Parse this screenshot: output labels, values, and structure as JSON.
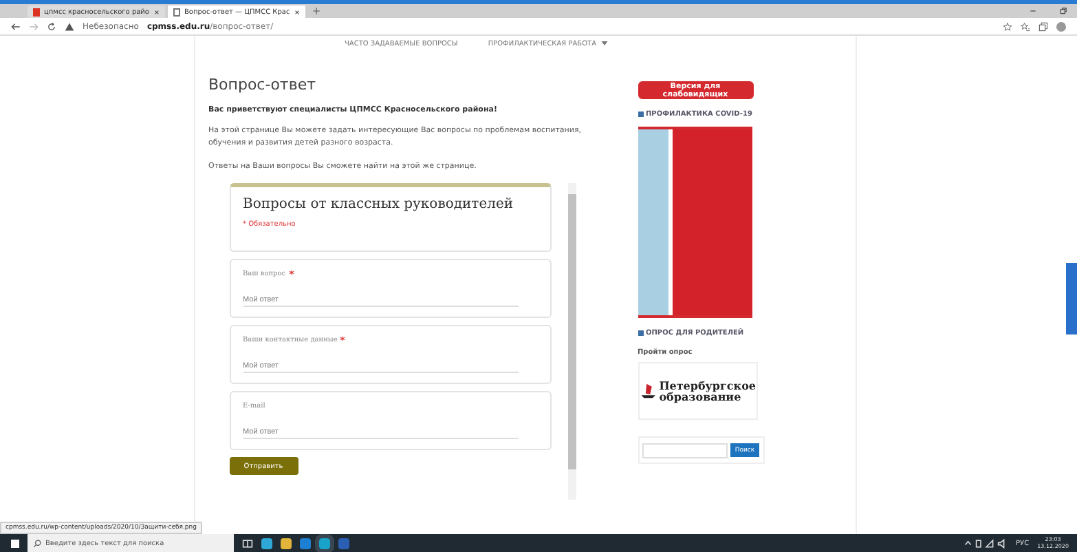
{
  "browser": {
    "tabs": [
      {
        "title": "цпмсс красносельского райо",
        "selected": false
      },
      {
        "title": "Вопрос-ответ — ЦПМСС Крас",
        "selected": true
      }
    ],
    "security": "Небезопасно",
    "url_host": "cpmss.edu.ru",
    "url_path": "/вопрос-ответ/"
  },
  "nav": [
    {
      "label": "ЧАСТО ЗАДАВАЕМЫЕ ВОПРОСЫ",
      "has_menu": false
    },
    {
      "label": "ПРОФИЛАКТИЧЕСКАЯ РАБОТА",
      "has_menu": true
    }
  ],
  "page": {
    "title": "Вопрос-ответ",
    "greeting": "Вас приветствуют специалисты ЦПМСС Красносельского района!",
    "intro": "На этой странице Вы можете задать интересующие Вас вопросы по проблемам воспитания, обучения и развития детей разного возраста.",
    "note": "Ответы на Ваши вопросы Вы сможете найти на этой же странице."
  },
  "form": {
    "title": "Вопросы от классных руководителей",
    "required_note": "* Обязательно",
    "questions": [
      {
        "label": "Ваш вопрос",
        "required": true,
        "placeholder": "Мой ответ"
      },
      {
        "label": "Ваши контактные данные",
        "required": true,
        "placeholder": "Мой ответ"
      },
      {
        "label": "E-mail",
        "required": false,
        "placeholder": "Мой ответ"
      }
    ],
    "submit": "Отправить"
  },
  "sidebar": {
    "accessibility_button": "Версия для слабовидящих",
    "covid_heading": "ПРОФИЛАКТИКА COVID-19",
    "survey_heading": "ОПРОС ДЛЯ РОДИТЕЛЕЙ",
    "survey_link": "Пройти опрос",
    "logo_lines": [
      "Петербургское",
      "образование"
    ],
    "search_button": "Поиск"
  },
  "status_url": "cpmss.edu.ru/wp-content/uploads/2020/10/Защити-себя.png",
  "taskbar": {
    "search_placeholder": "Введите здесь текст для поиска",
    "language": "РУС",
    "time": "23:03",
    "date": "13.12.2020"
  }
}
